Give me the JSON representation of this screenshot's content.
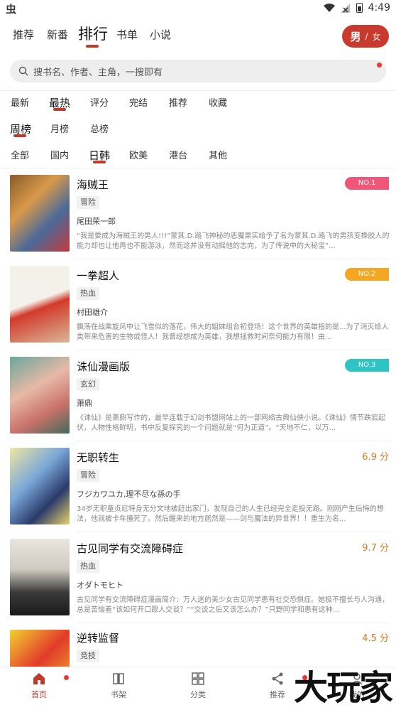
{
  "status": {
    "app_icon": "bug-icon",
    "time": "4:49"
  },
  "top_tabs": [
    "推荐",
    "新番",
    "排行",
    "书单",
    "小说"
  ],
  "active_top_tab": "排行",
  "gender": {
    "selected": "男",
    "separator": "/",
    "other": "女"
  },
  "search": {
    "placeholder": "搜书名、作者、主角，一搜即有"
  },
  "filters": {
    "sort": [
      "最新",
      "最热",
      "评分",
      "完结",
      "推荐",
      "收藏"
    ],
    "period": [
      "周榜",
      "月榜",
      "总榜"
    ],
    "region": [
      "全部",
      "国内",
      "日韩",
      "欧美",
      "港台",
      "其他"
    ]
  },
  "books": [
    {
      "title": "海贼王",
      "tag": "冒险",
      "author": "尾田荣一郎",
      "desc": "“我是要成为海贼王的男人!!!”蒙其.D.路飞神秘的恶魔果实给予了名为蒙其.D.路飞的男孩变橡胶人的能力却也让他再也不能游泳，然而这并没有动摇他的志向，为了传说中的大秘宝”...",
      "rank": "NO.1",
      "rank_color": "#f0557a"
    },
    {
      "title": "一拳超人",
      "tag": "热血",
      "author": "村田雄介",
      "desc": "飘荡在战乘旋风中让飞雪似的落花，伟大的姐妹组合初登场！这个世界的英雄指的是...为了消灭给人类带来危害的生物或怪人！我曾经想成为英雄，我想拯救时间奈何能力有限！由...",
      "rank": "NO.2",
      "rank_color": "#f5a623"
    },
    {
      "title": "诛仙漫画版",
      "tag": "玄幻",
      "author": "萧鼎",
      "desc": "《诛仙》是萧鼎写作的，最早连载于幻剑书盟网站上的一部网络古典仙侠小说。《诛仙》情节跌宕起伏，人物性格鲜明，书中反复探究的一个问题就是“何为正道”。“天地不仁，以万...",
      "rank": "NO.3",
      "rank_color": "#2ec4c4"
    },
    {
      "title": "无职转生",
      "tag": "冒险",
      "author": "フジカワユカ,理不尽な孫の手",
      "desc": "34岁无职童贞尼特身无分文地被赶出家门，发现自己的人生已经完全走投无路。刚刚产生后悔的想法，他就被卡车撞死了。然后醒来的地方居然是——剑与魔法的异世界！！重生为名...",
      "score": "6.9 分"
    },
    {
      "title": "古见同学有交流障碍症",
      "tag": "热血",
      "author": "オダトモヒト",
      "desc": "古见同学有交流障碍症漫画简介：万人迷的美少女古见同学患有社交恐惧症。她极不擅长与人沟通，总是苦恼着“该如何开口跟人交谈？”“交谈之后又该怎么办？”只野同学和患有这种...",
      "score": "9.7 分"
    },
    {
      "title": "逆转监督",
      "tag": "竞技",
      "author": "",
      "desc": "",
      "score": "4.5 分"
    }
  ],
  "bottom_nav": [
    {
      "label": "首页",
      "icon": "home-icon"
    },
    {
      "label": "书架",
      "icon": "bookshelf-icon"
    },
    {
      "label": "分类",
      "icon": "category-icon"
    },
    {
      "label": "推荐",
      "icon": "share-icon"
    },
    {
      "label": "我的",
      "icon": "user-icon"
    }
  ],
  "watermark": "大玩家",
  "colors": {
    "accent": "#c0392b",
    "gender_bg": "#c93a2e",
    "score": "#d97a1e"
  }
}
